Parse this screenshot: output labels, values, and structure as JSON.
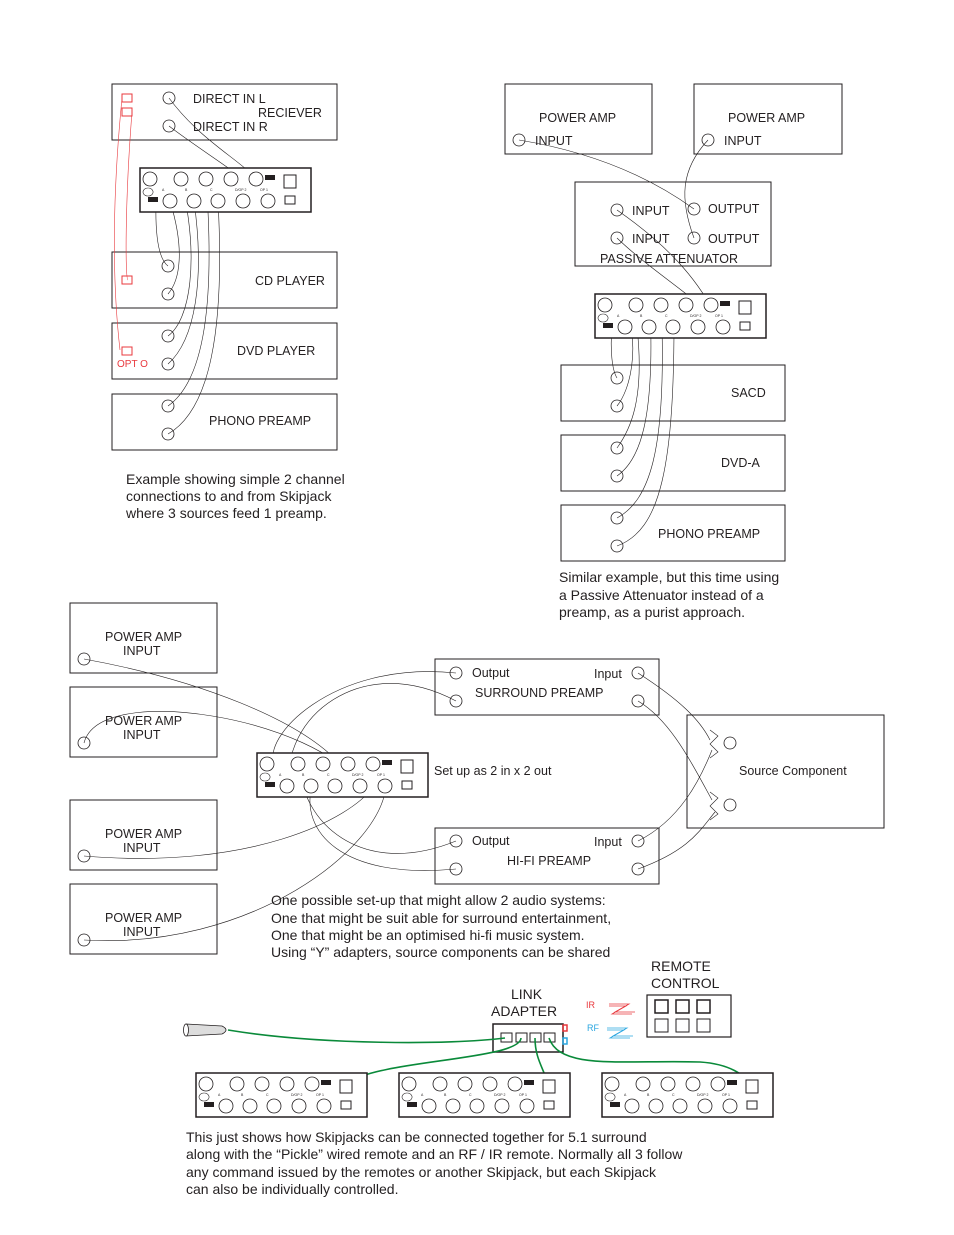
{
  "colors": {
    "optical": "#e8383d",
    "rf": "#2aa6e0",
    "link_cable": "#0a8a3a",
    "line": "#231f20"
  },
  "skipjack_labels": [
    "A",
    "B",
    "C",
    "D/OP 2",
    "OP 1"
  ],
  "diagram1": {
    "receiver": {
      "line1": "DIRECT IN L",
      "line2": "RECIEVER",
      "line3": "DIRECT IN R"
    },
    "cd": "CD PLAYER",
    "dvd": "DVD PLAYER",
    "opt": "OPT O",
    "phono": "PHONO PREAMP",
    "caption": [
      "Example showing simple 2 channel",
      "connections to and from Skipjack",
      "where 3 sources feed 1 preamp."
    ]
  },
  "diagram2": {
    "amp1": {
      "title": "POWER AMP",
      "input": "INPUT"
    },
    "amp2": {
      "title": "POWER AMP",
      "input": "INPUT"
    },
    "attenuator": {
      "in1": "INPUT",
      "in2": "INPUT",
      "out1": "OUTPUT",
      "out2": "OUTPUT",
      "title": "PASSIVE ATTENUATOR"
    },
    "sacd": "SACD",
    "dvda": "DVD-A",
    "phono": "PHONO PREAMP",
    "caption": [
      "Similar example, but this time using",
      "a Passive  Attenuator instead of a",
      "preamp, as a purist approach."
    ]
  },
  "diagram3": {
    "amps": [
      {
        "title": "POWER AMP",
        "input": "INPUT"
      },
      {
        "title": "POWER AMP",
        "input": "INPUT"
      },
      {
        "title": "POWER AMP",
        "input": "INPUT"
      },
      {
        "title": "POWER AMP",
        "input": "INPUT"
      }
    ],
    "surround": {
      "output": "Output",
      "input": "Input",
      "title": "SURROUND PREAMP"
    },
    "hifi": {
      "output": "Output",
      "input": "Input",
      "title": "HI-FI PREAMP"
    },
    "setup": "Set up  as 2 in x 2 out",
    "source": "Source Component",
    "caption": [
      "One possible set-up that might allow 2 audio systems:",
      "One that might be suit  able for surround entertainment,",
      "One that might be an optimised hi-fi music system.",
      "Using “Y” adapters, source components can be shared"
    ]
  },
  "diagram4": {
    "link": [
      "LINK",
      "ADAPTER"
    ],
    "remote": [
      "REMOTE",
      "CONTROL"
    ],
    "ir": "IR",
    "rf": "RF",
    "caption": [
      "This just shows how Skipjacks can be connected together for 5.1 surround",
      "along with the “Pickle” wired remote and an RF / IR remote. Normally all 3 follow",
      "any command issued by the remotes or another Skipjack, but each Skipjack",
      "can also be individually controlled."
    ]
  }
}
